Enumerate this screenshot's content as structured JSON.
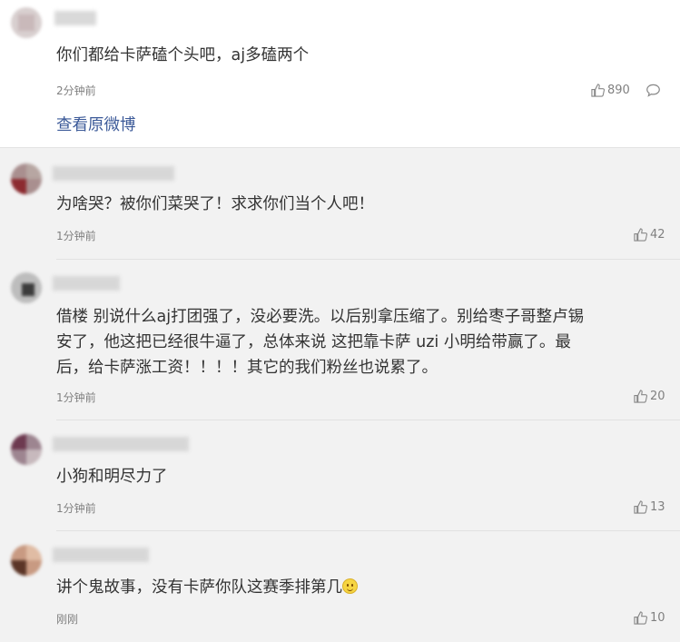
{
  "main_comment": {
    "text": "你们都给卡萨磕个头吧，aj多磕两个",
    "time": "2分钟前",
    "likes": "890",
    "view_original": "查看原微博"
  },
  "replies": [
    {
      "text_lines": [
        "为啥哭？被你们菜哭了！求求你们当个人吧！"
      ],
      "time": "1分钟前",
      "likes": "42"
    },
    {
      "text_lines": [
        "借楼 别说什么aj打团强了，没必要洗。以后别拿压缩了。别给枣子哥整卢锡",
        "安了，他这把已经很牛逼了，总体来说 这把靠卡萨 uzi 小明给带赢了。最",
        "后，给卡萨涨工资！！！！其它的我们粉丝也说累了。"
      ],
      "time": "1分钟前",
      "likes": "20"
    },
    {
      "text_lines": [
        "小狗和明尽力了"
      ],
      "time": "1分钟前",
      "likes": "13"
    },
    {
      "text_lines": [
        "讲个鬼故事，没有卡萨你队这赛季排第几"
      ],
      "time": "刚刚",
      "likes": "10",
      "emoji": "smile-emoji"
    }
  ],
  "icons": {
    "like": "thumbs-up-icon",
    "comment": "comment-bubble-icon"
  },
  "colors": {
    "link": "#3b5998",
    "reply_bg": "#f2f2f2",
    "meta": "#808080"
  }
}
